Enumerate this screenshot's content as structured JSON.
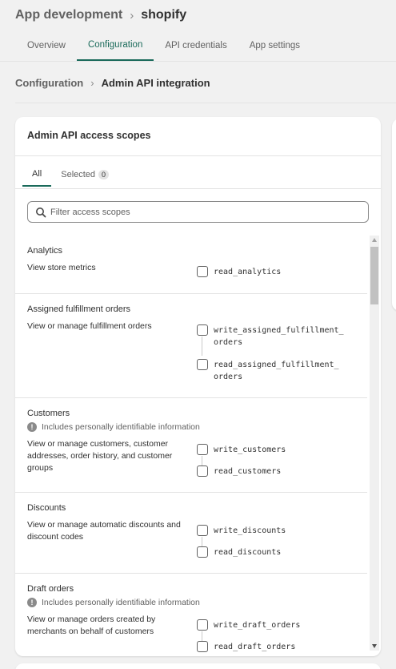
{
  "header": {
    "app_title": "App development",
    "separator": "›",
    "shop_name": "shopify"
  },
  "tabs": [
    {
      "label": "Overview",
      "active": false
    },
    {
      "label": "Configuration",
      "active": true
    },
    {
      "label": "API credentials",
      "active": false
    },
    {
      "label": "App settings",
      "active": false
    }
  ],
  "breadcrumb": {
    "parent": "Configuration",
    "separator": "›",
    "current": "Admin API integration"
  },
  "card": {
    "title": "Admin API access scopes",
    "filter_tabs": {
      "all": "All",
      "selected": "Selected",
      "selected_count": "0"
    },
    "search_placeholder": "Filter access scopes"
  },
  "pii_warning": "Includes personally identifiable information",
  "sections": [
    {
      "title": "Analytics",
      "description": "View store metrics",
      "scopes": [
        "read_analytics"
      ]
    },
    {
      "title": "Assigned fulfillment orders",
      "description": "View or manage fulfillment orders",
      "scopes": [
        "write_assigned_fulfillment_ orders",
        "read_assigned_fulfillment_ orders"
      ]
    },
    {
      "title": "Customers",
      "description": "View or manage customers, customer addresses, order history, and customer groups",
      "scopes": [
        "write_customers",
        "read_customers"
      ]
    },
    {
      "title": "Discounts",
      "description": "View or manage automatic discounts and discount codes",
      "scopes": [
        "write_discounts",
        "read_discounts"
      ]
    },
    {
      "title": "Draft orders",
      "description": "View or manage orders created by merchants on behalf of customers",
      "scopes": [
        "write_draft_orders",
        "read_draft_orders"
      ]
    }
  ],
  "colors": {
    "accent": "#1a6a5a",
    "background": "#f1f1f1",
    "card": "#ffffff"
  }
}
